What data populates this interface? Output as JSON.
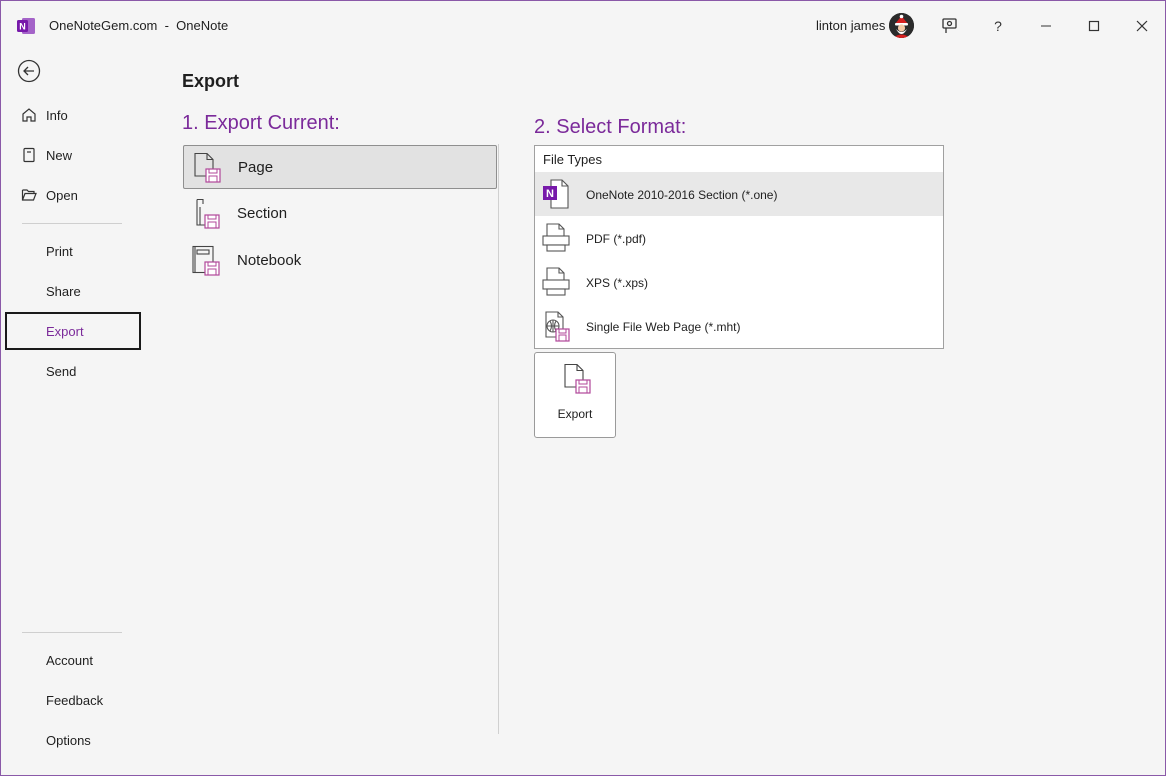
{
  "window": {
    "title": "OneNoteGem.com  -  OneNote",
    "user_name": "linton james",
    "accent": "#7b2a9a"
  },
  "sidebar": {
    "items": [
      {
        "label": "Info",
        "icon": "home-icon"
      },
      {
        "label": "New",
        "icon": "new-page-icon"
      },
      {
        "label": "Open",
        "icon": "folder-open-icon"
      },
      {
        "label": "Print"
      },
      {
        "label": "Share"
      },
      {
        "label": "Export",
        "active": true
      },
      {
        "label": "Send"
      }
    ],
    "bottom_items": [
      {
        "label": "Account"
      },
      {
        "label": "Feedback"
      },
      {
        "label": "Options"
      }
    ]
  },
  "main": {
    "title": "Export",
    "export_current": {
      "heading": "1. Export Current:",
      "items": [
        {
          "label": "Page",
          "selected": true
        },
        {
          "label": "Section"
        },
        {
          "label": "Notebook"
        }
      ]
    },
    "select_format": {
      "heading": "2. Select Format:",
      "list_header": "File Types",
      "items": [
        {
          "label": "OneNote 2010-2016 Section (*.one)",
          "selected": true
        },
        {
          "label": "PDF (*.pdf)"
        },
        {
          "label": "XPS (*.xps)"
        },
        {
          "label": "Single File Web Page (*.mht)"
        }
      ]
    },
    "export_button": {
      "label": "Export"
    }
  }
}
